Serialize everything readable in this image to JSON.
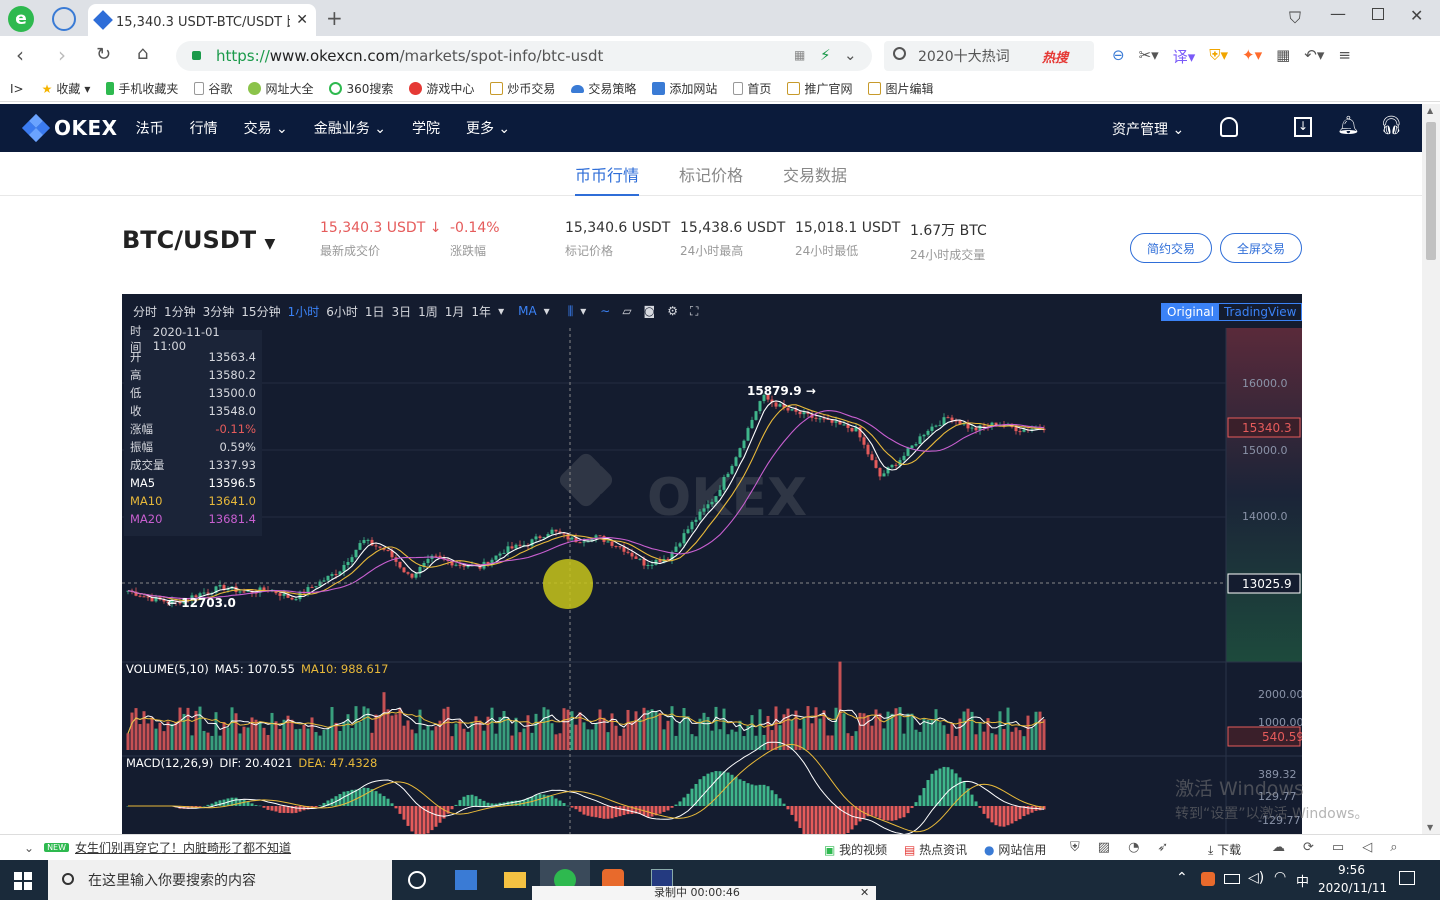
{
  "browser": {
    "tab_title": "15,340.3 USDT-BTC/USDT 比",
    "url_prefix": "https://",
    "url_domain": "www.okexcn.com",
    "url_path": "/markets/spot-info/btc-usdt",
    "search_text": "2020十大热词",
    "search_badge": "热搜",
    "bookmarks": [
      "收藏",
      "手机收藏夹",
      "谷歌",
      "网址大全",
      "360搜索",
      "游戏中心",
      "炒币交易",
      "交易策略",
      "添加网站",
      "首页",
      "推广官网",
      "图片编辑"
    ]
  },
  "okex": {
    "logo": "OKEX",
    "nav": [
      "法币",
      "行情",
      "交易",
      "金融业务",
      "学院",
      "更多"
    ],
    "asset_mgmt": "资产管理",
    "subtabs": [
      "币币行情",
      "标记价格",
      "交易数据"
    ],
    "pair": "BTC/USDT",
    "ticker": [
      {
        "value": "15,340.3 USDT ↓",
        "label": "最新成交价",
        "color": "#e55b5b"
      },
      {
        "value": "-0.14%",
        "label": "涨跌幅",
        "color": "#e55b5b"
      },
      {
        "value": "15,340.6 USDT",
        "label": "标记价格",
        "color": "#333333"
      },
      {
        "value": "15,438.6 USDT",
        "label": "24小时最高",
        "color": "#333333"
      },
      {
        "value": "15,018.1 USDT",
        "label": "24小时最低",
        "color": "#333333"
      },
      {
        "value": "1.67万 BTC",
        "label": "24小时成交量",
        "color": "#333333"
      }
    ],
    "btn_simple": "简约交易",
    "btn_full": "全屏交易"
  },
  "chart_toolbar": {
    "intervals": [
      "分时",
      "1分钟",
      "3分钟",
      "15分钟",
      "1小时",
      "6小时",
      "1日",
      "3日",
      "1周",
      "1月",
      "1年"
    ],
    "active_interval": "1小时",
    "indicator": "MA",
    "mode_original": "Original",
    "mode_tv": "TradingView"
  },
  "ohlc": {
    "rows": [
      {
        "k": "时间",
        "v": "2020-11-01 11:00",
        "c": "#d6d8de"
      },
      {
        "k": "开",
        "v": "13563.4",
        "c": "#d6d8de"
      },
      {
        "k": "高",
        "v": "13580.2",
        "c": "#d6d8de"
      },
      {
        "k": "低",
        "v": "13500.0",
        "c": "#d6d8de"
      },
      {
        "k": "收",
        "v": "13548.0",
        "c": "#d6d8de"
      },
      {
        "k": "涨幅",
        "v": "-0.11%",
        "c": "#e55b5b"
      },
      {
        "k": "振幅",
        "v": "0.59%",
        "c": "#d6d8de"
      },
      {
        "k": "成交量",
        "v": "1337.93",
        "c": "#d6d8de"
      },
      {
        "k": "MA5",
        "v": "13596.5",
        "c": "#ffffff"
      },
      {
        "k": "MA10",
        "v": "13641.0",
        "c": "#e8b93a"
      },
      {
        "k": "MA20",
        "v": "13681.4",
        "c": "#c85fd0"
      }
    ]
  },
  "chart_data": {
    "type": "line",
    "title": "BTC/USDT 1小时",
    "y_ticks": [
      "16000.0",
      "15000.0",
      "14000.0"
    ],
    "current_price": "15340.3",
    "crosshair_price": "13025.9",
    "max_label": "15879.9",
    "min_label": "12703.0",
    "watermark": "OKEX",
    "series": [
      {
        "name": "price",
        "x": [
          0,
          1,
          2,
          3,
          4,
          5,
          6,
          7,
          8,
          9,
          10,
          11,
          12,
          13,
          14,
          15,
          16,
          17,
          18,
          19,
          20,
          21,
          22,
          23,
          24,
          25,
          26,
          27,
          28,
          29,
          30,
          31,
          32,
          33,
          34,
          35,
          36,
          37,
          38,
          39
        ],
        "values": [
          12900,
          12780,
          12720,
          12850,
          12950,
          12880,
          12920,
          12780,
          12990,
          13200,
          13650,
          13500,
          13100,
          13400,
          13300,
          13250,
          13500,
          13600,
          13800,
          13650,
          13700,
          13550,
          13300,
          13400,
          13900,
          14300,
          15000,
          15800,
          15600,
          15500,
          15400,
          15300,
          14600,
          14900,
          15300,
          15500,
          15300,
          15400,
          15300,
          15340
        ]
      }
    ],
    "volume": {
      "label": "VOLUME(5,10)",
      "ma5": "MA5: 1070.55",
      "ma10": "MA10: 988.617",
      "ticks": [
        "2000.00",
        "1000.00"
      ],
      "current": "540.59"
    },
    "macd": {
      "label": "MACD(12,26,9)",
      "dif": "DIF: 20.4021",
      "dea": "DEA: 47.4328",
      "ticks": [
        "389.32",
        "129.77",
        "-129.77"
      ]
    }
  },
  "status": {
    "news_badge": "NEW",
    "news": "女生们别再穿它了！内脏畸形了都不知道",
    "items": [
      "我的视频",
      "热点资讯",
      "网站信用",
      "下载"
    ]
  },
  "watermark_os": {
    "line1": "激活 Windows",
    "line2": "转到“设置”以激活 Windows。"
  },
  "taskbar": {
    "search_placeholder": "在这里输入你要搜索的内容",
    "recording": "录制中  00:00:46",
    "ime": "中",
    "time": "9:56",
    "date": "2020/11/11"
  }
}
